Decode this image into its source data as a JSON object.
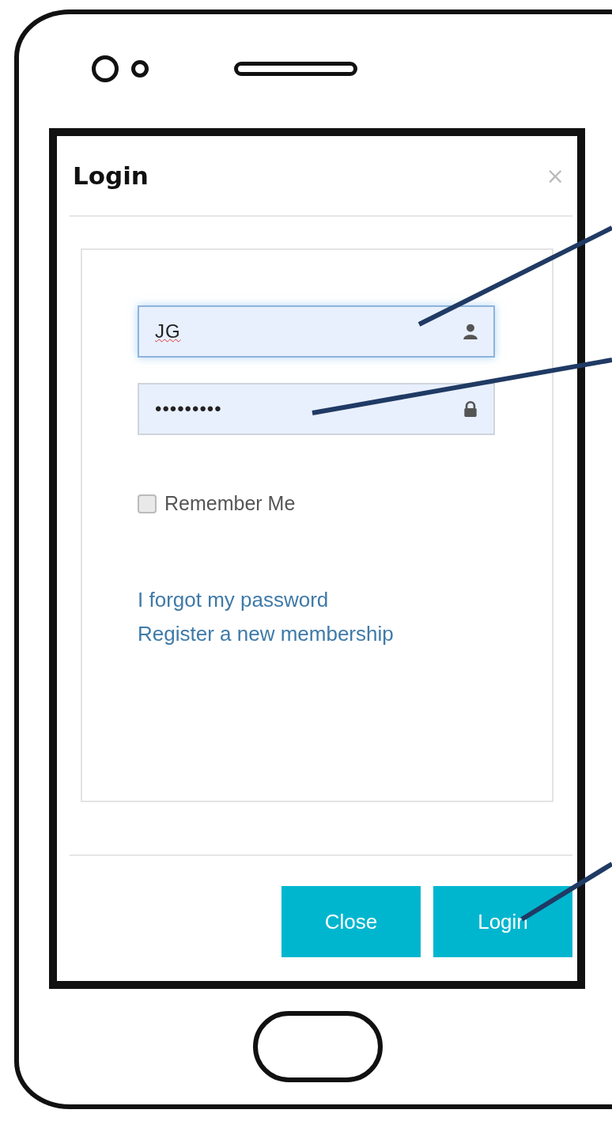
{
  "dialog": {
    "title": "Login",
    "close": "×"
  },
  "fields": [
    {
      "kind": "username",
      "value": "JG",
      "focused": true
    },
    {
      "kind": "password",
      "value": "•••••••••",
      "focused": false
    }
  ],
  "remember": {
    "label": "Remember Me",
    "checked": false
  },
  "links": [
    "I forgot my password",
    "Register a new membership"
  ],
  "buttons": [
    "Close",
    "Login"
  ]
}
